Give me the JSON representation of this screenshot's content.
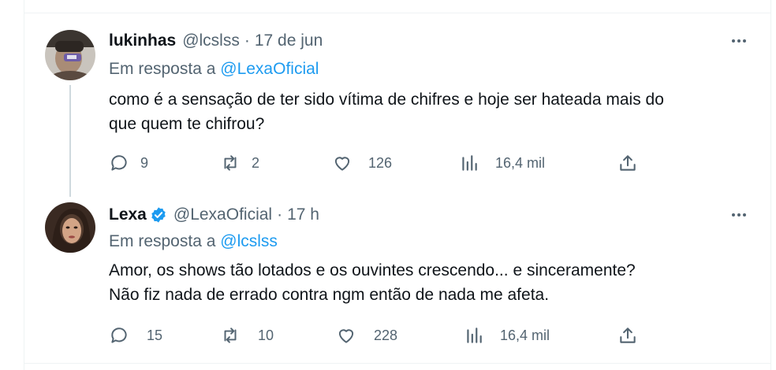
{
  "tweets": [
    {
      "name": "lukinhas",
      "handle": "@lcslss",
      "separator": "·",
      "time": "17 de jun",
      "reply_prefix": "Em resposta a",
      "reply_mention": "@LexaOficial",
      "text_lines": [
        "como é a sensação de ter sido vítima de chifres e hoje ser hateada mais do",
        "que quem te chifrou?"
      ],
      "replies": "9",
      "retweets": "2",
      "likes": "126",
      "views": "16,4 mil",
      "verified": false
    },
    {
      "name": "Lexa",
      "handle": "@LexaOficial",
      "separator": "·",
      "time": "17 h",
      "reply_prefix": "Em resposta a",
      "reply_mention": "@lcslss",
      "text_lines": [
        "Amor, os shows tão lotados e os ouvintes crescendo... e sinceramente?",
        "Não fiz nada de errado contra ngm então de nada me afeta."
      ],
      "replies": "15",
      "retweets": "10",
      "likes": "228",
      "views": "16,4 mil",
      "verified": true
    }
  ],
  "icons": {
    "reply": "speech-bubble-icon",
    "retweet": "retweet-icon",
    "like": "heart-icon",
    "views": "bar-chart-icon",
    "share": "share-icon",
    "more": "more-dots-icon",
    "verified": "verified-badge-icon"
  },
  "colors": {
    "text": "#0f1419",
    "secondary": "#536471",
    "accent": "#1d9bf0",
    "thread_line": "#cfd9de"
  }
}
